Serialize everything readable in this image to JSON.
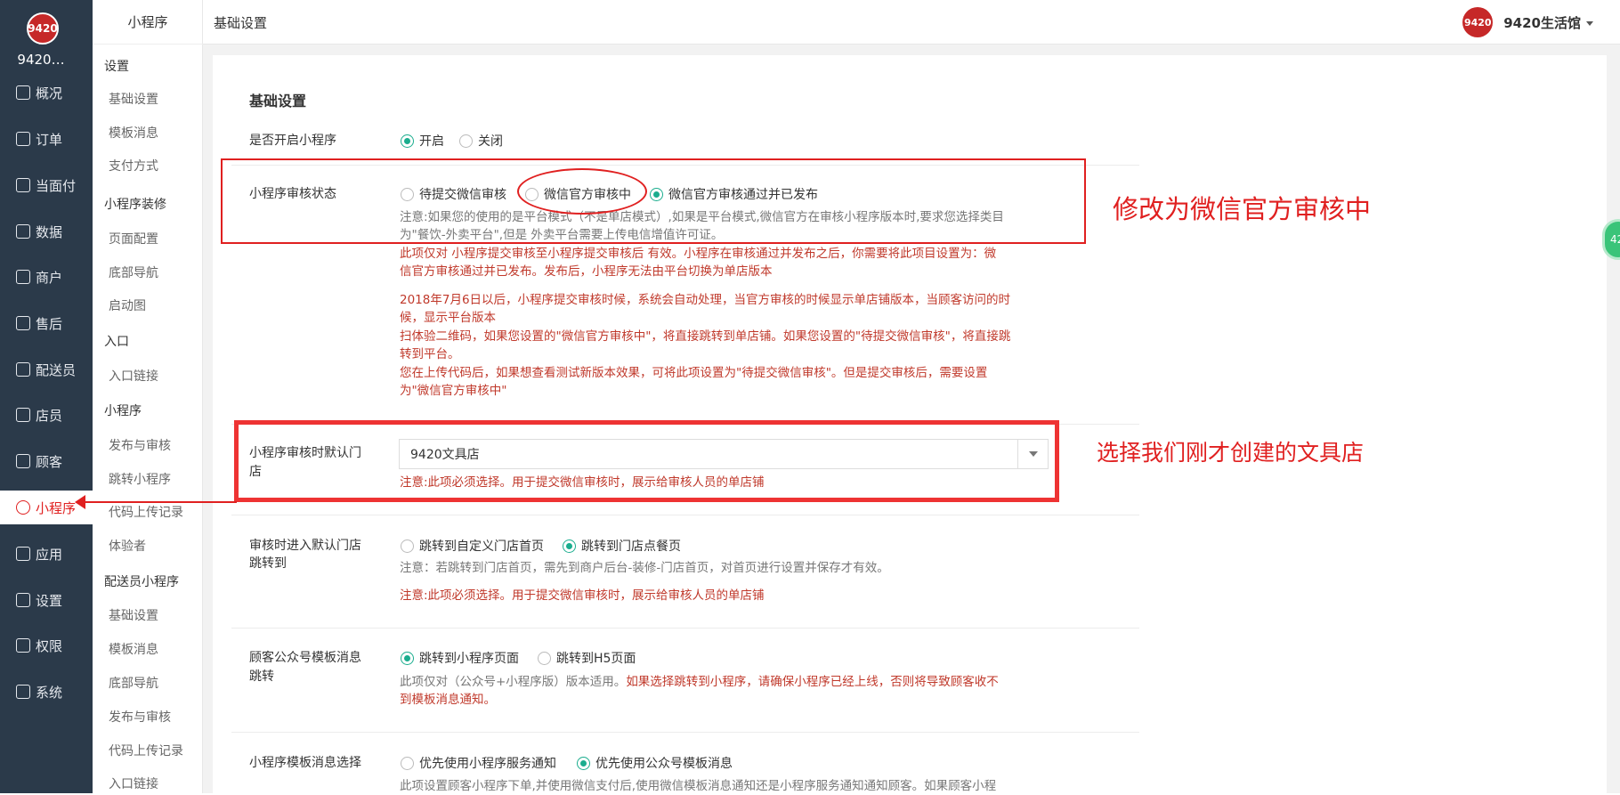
{
  "brand": {
    "shop_name": "9420…",
    "logo_text": "9420",
    "user_name": "9420生活馆"
  },
  "leftnav": {
    "items": [
      {
        "label": "概况",
        "icon": "dashboard-icon"
      },
      {
        "label": "订单",
        "icon": "order-icon"
      },
      {
        "label": "当面付",
        "icon": "pay-icon"
      },
      {
        "label": "数据",
        "icon": "chart-icon"
      },
      {
        "label": "商户",
        "icon": "store-icon"
      },
      {
        "label": "售后",
        "icon": "service-icon"
      },
      {
        "label": "配送员",
        "icon": "courier-icon"
      },
      {
        "label": "店员",
        "icon": "staff-icon"
      },
      {
        "label": "顾客",
        "icon": "customer-icon"
      },
      {
        "label": "小程序",
        "icon": "miniprogram-icon",
        "active": true
      },
      {
        "label": "应用",
        "icon": "apps-icon"
      },
      {
        "label": "设置",
        "icon": "gear-icon"
      },
      {
        "label": "权限",
        "icon": "lock-icon"
      },
      {
        "label": "系统",
        "icon": "system-icon"
      }
    ]
  },
  "subnav": {
    "title": "小程序",
    "groups": [
      {
        "title": "设置",
        "items": [
          "基础设置",
          "模板消息",
          "支付方式"
        ]
      },
      {
        "title": "小程序装修",
        "items": [
          "页面配置",
          "底部导航",
          "启动图"
        ]
      },
      {
        "title": "入口",
        "items": [
          "入口链接"
        ]
      },
      {
        "title": "小程序",
        "items": [
          "发布与审核",
          "跳转小程序",
          "代码上传记录",
          "体验者"
        ]
      },
      {
        "title": "配送员小程序",
        "items": [
          "基础设置",
          "模板消息",
          "底部导航",
          "发布与审核",
          "代码上传记录",
          "入口链接"
        ]
      }
    ]
  },
  "topbar": {
    "breadcrumb": "基础设置"
  },
  "form": {
    "section_title": "基础设置",
    "enable": {
      "label": "是否开启小程序",
      "options": [
        "开启",
        "关闭"
      ],
      "selected": "开启"
    },
    "review_status": {
      "label": "小程序审核状态",
      "options": [
        "待提交微信审核",
        "微信官方审核中",
        "微信官方审核通过并已发布"
      ],
      "selected": "微信官方审核通过并已发布",
      "note_gray_1": "注意:如果您的使用的是平台模式（不是单店模式）,如果是平台模式,微信官方在审核小程序版本时,要求您选择类目",
      "note_gray_2": "为\"餐饮-外卖平台\",但是 外卖平台需要上传电信增值许可证。",
      "note_red_1": "此项仅对 小程序提交审核至小程序提交审核后 有效。小程序在审核通过并发布之后，你需要将此项目设置为：微",
      "note_red_2": "信官方审核通过并已发布。发布后，小程序无法由平台切换为单店版本",
      "note_red_3": "2018年7月6日以后，小程序提交审核时候，系统会自动处理，当官方审核的时候显示单店铺版本，当顾客访问的时",
      "note_red_4": "候，显示平台版本",
      "note_red_5": "扫体验二维码，如果您设置的\"微信官方审核中\"，将直接跳转到单店铺。如果您设置的\"待提交微信审核\"，将直接跳",
      "note_red_6": "转到平台。",
      "note_red_7": "您在上传代码后，如果想查看测试新版本效果，可将此项设置为\"待提交微信审核\"。但是提交审核后，需要设置",
      "note_red_8": "为\"微信官方审核中\""
    },
    "default_store": {
      "label_1": "小程序审核时默认门",
      "label_2": "店",
      "value": "9420文具店",
      "note": "注意:此项必须选择。用于提交微信审核时，展示给审核人员的单店铺"
    },
    "jump": {
      "label_1": "审核时进入默认门店",
      "label_2": "跳转到",
      "options": [
        "跳转到自定义门店首页",
        "跳转到门店点餐页"
      ],
      "selected": "跳转到门店点餐页",
      "note_gray": "注意：若跳转到门店首页，需先到商户后台-装修-门店首页，对首页进行设置并保存才有效。",
      "note_red": "注意:此项必须选择。用于提交微信审核时，展示给审核人员的单店铺"
    },
    "template_jump": {
      "label_1": "顾客公众号模板消息",
      "label_2": "跳转",
      "options": [
        "跳转到小程序页面",
        "跳转到H5页面"
      ],
      "selected": "跳转到小程序页面",
      "note_gray": "此项仅对（公众号+小程序版）版本适用。",
      "note_red_1": "如果选择跳转到小程序，请确保小程序已经上线，否则将导致顾客收不",
      "note_red_2": "到模板消息通知。"
    },
    "template_select": {
      "label": "小程序模板消息选择",
      "options": [
        "优先使用小程序服务通知",
        "优先使用公众号模板消息"
      ],
      "selected": "优先使用公众号模板消息",
      "note_gray": "此项设置顾客小程序下单,并使用微信支付后,使用微信模板消息通知还是小程序服务通知通知顾客。如果顾客小程"
    }
  },
  "annotations": {
    "text_1": "修改为微信官方审核中",
    "text_2": "选择我们刚才创建的文具店",
    "color": "#e02020"
  },
  "float_badge": "42"
}
